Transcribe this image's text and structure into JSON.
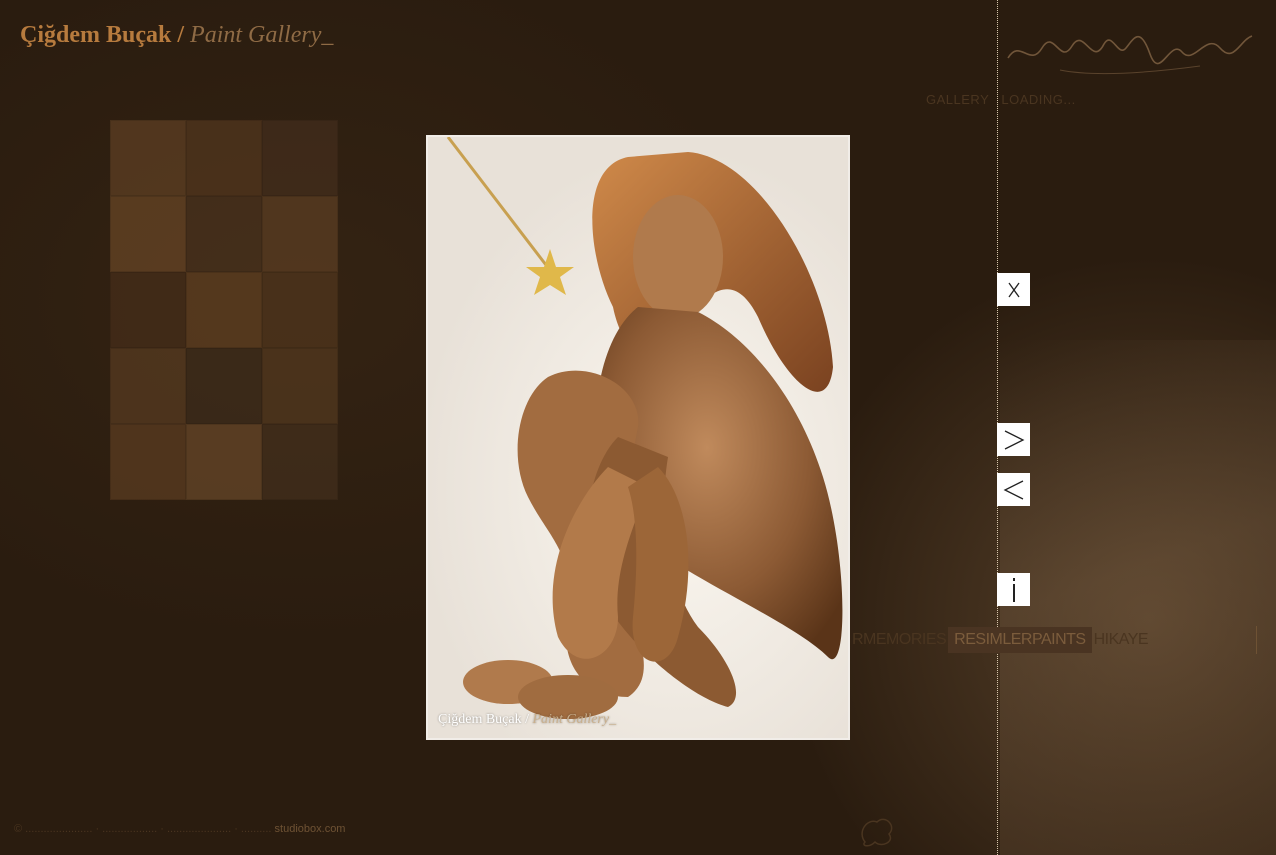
{
  "header": {
    "name": "Çiğdem Buçak",
    "separator": "/",
    "subtitle": "Paint Gallery_"
  },
  "top_menu": {
    "gallery": "GALLERY",
    "loading": "LOADING..."
  },
  "photo": {
    "caption_name": "Çiğdem Buçak /",
    "caption_subtitle": "Paint Gallery_"
  },
  "controls": {
    "close": "X",
    "next": ">",
    "prev": "<",
    "info": "i"
  },
  "bottom_menu": {
    "items": [
      "RMEMORIES",
      "RESIMLERPAINTS",
      "HIKAYE"
    ],
    "active_index": 1
  },
  "footer": {
    "text": "© ...................... · .................. · ..................... · ..........",
    "credit": "studiobox.com"
  },
  "corner": {
    "line1": "... ...... .....",
    "line2": "..... ....."
  },
  "colors": {
    "background": "#2a1c0f",
    "title": "#b77b3e",
    "subtitle": "#8f6b45",
    "control_bg": "#ffffff",
    "divider": "#d8c7ad"
  }
}
